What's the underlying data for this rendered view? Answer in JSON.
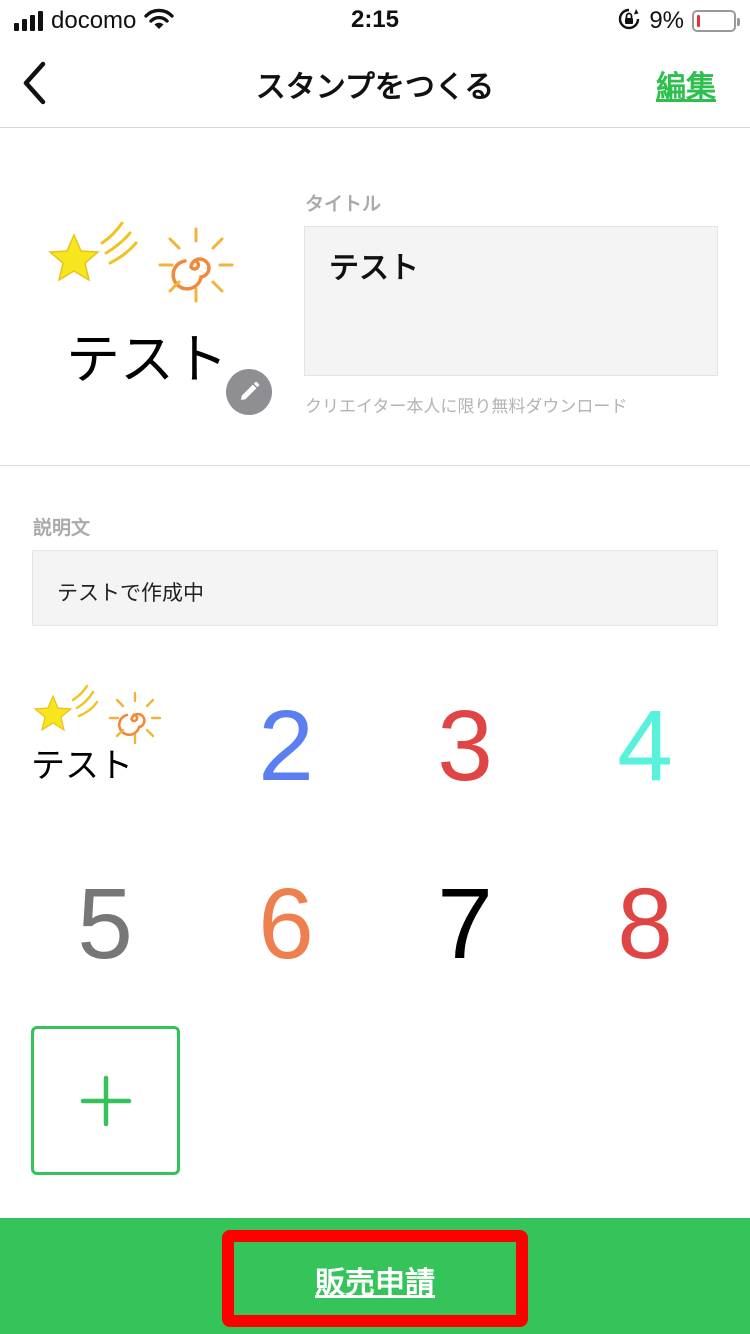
{
  "status_bar": {
    "carrier": "docomo",
    "time": "2:15",
    "battery_percent": "9%",
    "battery_level": 0.09,
    "icons": [
      "signal-icon",
      "wifi-icon",
      "orientation-lock-icon",
      "battery-icon"
    ]
  },
  "nav": {
    "title": "スタンプをつくる",
    "edit_label": "編集",
    "back_icon": "chevron-left-icon"
  },
  "cover": {
    "image_text": "テスト",
    "title_label": "タイトル",
    "title_value": "テスト",
    "download_note": "クリエイター本人に限り無料ダウンロード",
    "edit_icon": "pencil-icon"
  },
  "description": {
    "label": "説明文",
    "value": "テストで作成中"
  },
  "stamps": {
    "first_text": "テスト",
    "items": [
      {
        "label": "2",
        "color": "#5b7ff0"
      },
      {
        "label": "3",
        "color": "#e04545"
      },
      {
        "label": "4",
        "color": "#58f2dc"
      },
      {
        "label": "5",
        "color": "#777777"
      },
      {
        "label": "6",
        "color": "#ee8050"
      },
      {
        "label": "7",
        "color": "#000000"
      },
      {
        "label": "8",
        "color": "#e04545"
      }
    ],
    "add_icon": "plus-icon"
  },
  "footer": {
    "submit_label": "販売申請"
  },
  "colors": {
    "accent": "#35c459",
    "highlight": "#ff0000"
  }
}
